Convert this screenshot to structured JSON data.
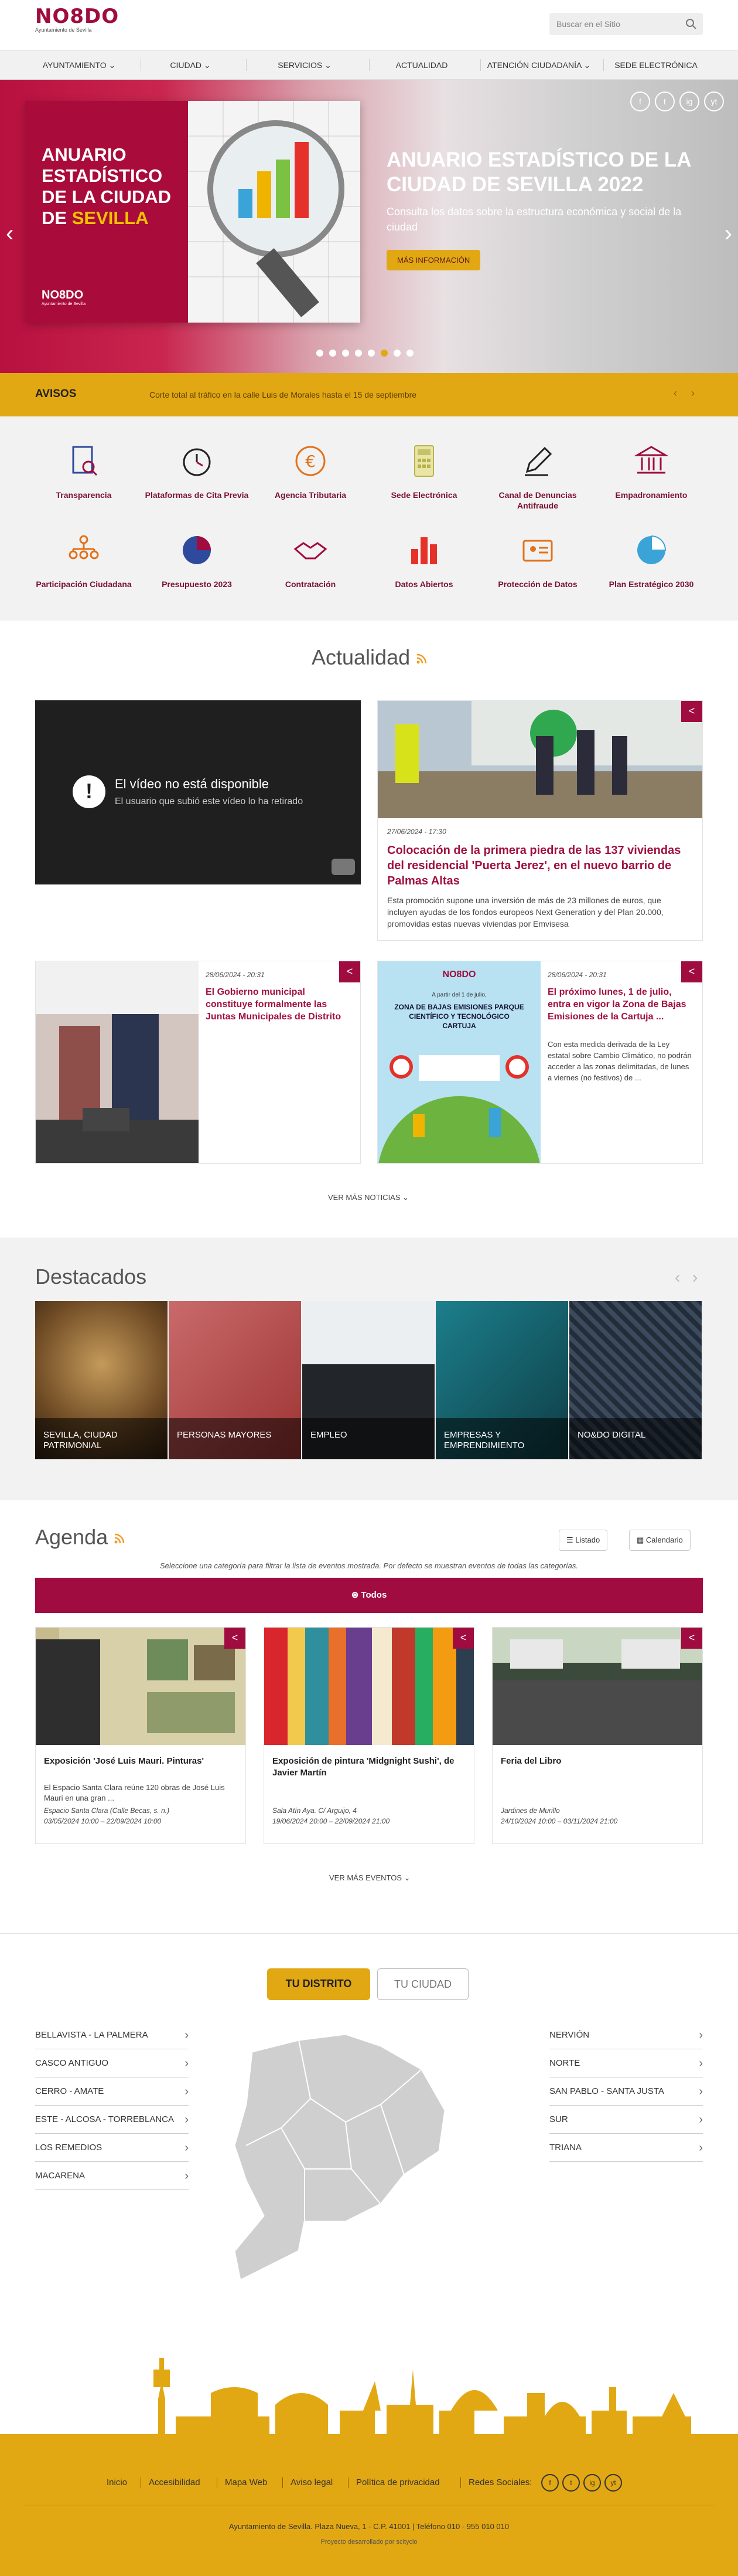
{
  "header": {
    "logo_text": "NO8DO",
    "logo_sub": "Ayuntamiento de Sevilla",
    "search_placeholder": "Buscar en el Sitio"
  },
  "nav": [
    {
      "label": "AYUNTAMIENTO ⌄"
    },
    {
      "label": "CIUDAD ⌄"
    },
    {
      "label": "SERVICIOS ⌄"
    },
    {
      "label": "ACTUALIDAD"
    },
    {
      "label": "ATENCIÓN CIUDADANÍA ⌄"
    },
    {
      "label": "SEDE ELECTRÓNICA"
    }
  ],
  "hero": {
    "card_title_1": "ANUARIO ESTADÍSTICO DE LA CIUDAD DE",
    "card_title_2": "SEVILLA",
    "card_logo": "NO8DO",
    "card_logo_sub": "Ayuntamiento de Sevilla",
    "title": "ANUARIO ESTADÍSTICO DE LA CIUDAD DE SEVILLA 2022",
    "subtitle": "Consulta los datos sobre la estructura económica y social de la ciudad",
    "button": "MÁS INFORMACIÓN",
    "prev": "‹",
    "next": "›",
    "active_slide": 5,
    "slide_count": 8
  },
  "social": [
    "f",
    "t",
    "ig",
    "yt"
  ],
  "avisos": {
    "label": "AVISOS",
    "text": "Corte total al tráfico en la calle Luis de Morales hasta el 15 de septiembre",
    "prev": "‹",
    "next": "›"
  },
  "services": [
    {
      "label": "Transparencia",
      "icon": "document-search-icon"
    },
    {
      "label": "Plataformas de Cita Previa",
      "icon": "clock-icon"
    },
    {
      "label": "Agencia Tributaria",
      "icon": "euro-icon"
    },
    {
      "label": "Sede Electrónica",
      "icon": "calculator-icon"
    },
    {
      "label": "Canal de Denuncias Antifraude",
      "icon": "pen-icon"
    },
    {
      "label": "Empadronamiento",
      "icon": "building-icon"
    },
    {
      "label": "Participación Ciudadana",
      "icon": "people-icon"
    },
    {
      "label": "Presupuesto 2023",
      "icon": "pie-chart-icon"
    },
    {
      "label": "Contratación",
      "icon": "handshake-icon"
    },
    {
      "label": "Datos Abiertos",
      "icon": "bar-chart-icon"
    },
    {
      "label": "Protección de Datos",
      "icon": "id-card-icon"
    },
    {
      "label": "Plan Estratégico 2030",
      "icon": "pie-chart-icon"
    }
  ],
  "actualidad": {
    "title": "Actualidad",
    "video_title": "El vídeo no está disponible",
    "video_sub": "El usuario que subió este vídeo lo ha retirado",
    "featured": {
      "date": "27/06/2024 - 17:30",
      "title": "Colocación de la primera piedra de las 137 viviendas del residencial 'Puerta Jerez', en el nuevo barrio de Palmas Altas",
      "text": "Esta promoción supone una inversión de más de 23 millones de euros, que incluyen ayudas de los fondos europeos Next Generation y del Plan 20.000, promovidas estas nuevas viviendas por Emvisesa"
    },
    "news2": {
      "date": "28/06/2024 - 20:31",
      "title": "El Gobierno municipal constituye formalmente las Juntas Municipales de Distrito"
    },
    "news3": {
      "date": "28/06/2024 - 20:31",
      "title": "El próximo lunes, 1 de julio, entra en vigor la Zona de Bajas Emisiones de la Cartuja ...",
      "text": "Con esta medida derivada de la Ley estatal sobre Cambio Climático, no podrán acceder a las zonas delimitadas, de lunes a viernes (no festivos) de ...",
      "poster_logo": "NO8DO",
      "poster_small": "A partir del 1 de julio,",
      "poster_big": "ZONA DE BAJAS EMISIONES PARQUE CIENTÍFICO Y TECNOLÓGICO CARTUJA"
    },
    "more": "VER MÁS NOTICIAS ⌄"
  },
  "destacados": {
    "title": "Destacados",
    "prev": "‹",
    "next": "›",
    "items": [
      {
        "label": "SEVILLA, CIUDAD PATRIMONIAL"
      },
      {
        "label": "PERSONAS MAYORES"
      },
      {
        "label": "EMPLEO"
      },
      {
        "label": "EMPRESAS Y EMPRENDIMIENTO"
      },
      {
        "label": "NO&DO DIGITAL"
      }
    ]
  },
  "agenda": {
    "title": "Agenda",
    "listado": "Listado",
    "calendario": "Calendario",
    "hint": "Seleccione una categoría para filtrar la lista de eventos mostrada. Por defecto se muestran eventos de todas las categorías.",
    "todos": "⊛ Todos",
    "events": [
      {
        "title": "Exposición 'José Luis Mauri. Pinturas'",
        "desc": "El Espacio Santa Clara reúne 120 obras de José Luis Mauri en una gran ...",
        "place": "Espacio Santa Clara (Calle Becas, s. n.)",
        "dates": "03/05/2024 10:00 – 22/09/2024 10:00"
      },
      {
        "title": "Exposición de pintura 'Midgnight Sushi', de Javier Martín",
        "desc": "",
        "place": "Sala Atín Aya. C/ Arguijo, 4",
        "dates": "19/06/2024 20:00 – 22/09/2024 21:00"
      },
      {
        "title": "Feria del Libro",
        "desc": "",
        "place": "Jardines de Murillo",
        "dates": "24/10/2024 10:00 – 03/11/2024 21:00"
      }
    ],
    "more": "VER MÁS EVENTOS ⌄"
  },
  "distritos": {
    "tab_active": "TU DISTRITO",
    "tab_inactive": "TU CIUDAD",
    "left": [
      "BELLAVISTA - LA PALMERA",
      "CASCO ANTIGUO",
      "CERRO - AMATE",
      "ESTE - ALCOSA - TORREBLANCA",
      "LOS REMEDIOS",
      "MACARENA"
    ],
    "right": [
      "NERVIÓN",
      "NORTE",
      "SAN PABLO - SANTA JUSTA",
      "SUR",
      "TRIANA"
    ]
  },
  "footer": {
    "links": [
      "Inicio",
      "Accesibilidad",
      "Mapa Web",
      "Aviso legal",
      "Política de privacidad"
    ],
    "social_label": "Redes Sociales:",
    "address": "Ayuntamiento de Sevilla. Plaza Nueva, 1 - C.P. 41001 | Teléfono 010 - 955 010 010",
    "credits": "Proyecto desarrollado por scityclo"
  },
  "colors": {
    "brand": "#a00c3f",
    "accent": "#e2a813"
  }
}
